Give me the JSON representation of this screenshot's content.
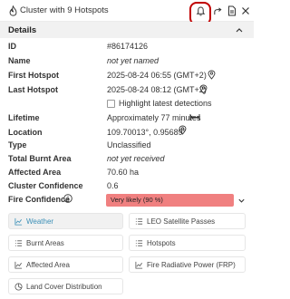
{
  "header": {
    "title": "Cluster with 9 Hotspots",
    "flame_icon": "flame-icon",
    "bell_icon": "bell-icon",
    "share_icon": "share-icon",
    "export_icon": "document-icon",
    "close_icon": "close-icon"
  },
  "details": {
    "title": "Details",
    "rows": {
      "id": {
        "label": "ID",
        "value": "#86174126"
      },
      "name": {
        "label": "Name",
        "value": "not yet named"
      },
      "first_hotspot": {
        "label": "First Hotspot",
        "value": "2025-08-24 06:55 (GMT+2)"
      },
      "last_hotspot": {
        "label": "Last Hotspot",
        "value": "2025-08-24 08:12 (GMT+2)"
      },
      "lifetime": {
        "label": "Lifetime",
        "value": "Approximately 77 minutes"
      },
      "location": {
        "label": "Location",
        "value": "109.70013°, 0.95689°"
      },
      "type": {
        "label": "Type",
        "value": "Unclassified"
      },
      "total_burnt_area": {
        "label": "Total Burnt Area",
        "value": "not yet received"
      },
      "affected_area": {
        "label": "Affected Area",
        "value": "70.60 ha"
      },
      "cluster_confidence": {
        "label": "Cluster Confidence",
        "value": "0.6"
      },
      "fire_confidence": {
        "label": "Fire Confidence",
        "value": "Very likely (90 %)"
      }
    },
    "highlight_label": "Highlight latest detections",
    "highlight_checked": false
  },
  "tools": [
    {
      "label": "Weather",
      "icon": "chart-icon",
      "active": true
    },
    {
      "label": "LEO Satellite Passes",
      "icon": "list-icon",
      "active": false
    },
    {
      "label": "Burnt Areas",
      "icon": "list-icon",
      "active": false
    },
    {
      "label": "Hotspots",
      "icon": "list-icon",
      "active": false
    },
    {
      "label": "Affected Area",
      "icon": "chart-icon",
      "active": false
    },
    {
      "label": "Fire Radiative Power (FRP)",
      "icon": "chart-icon",
      "active": false
    },
    {
      "label": "Land Cover Distribution",
      "icon": "pie-icon",
      "active": false
    }
  ],
  "colors": {
    "confidence_badge": "#f08080",
    "highlight_ring": "#c00000",
    "active_tool_text": "#3a8fb7"
  }
}
